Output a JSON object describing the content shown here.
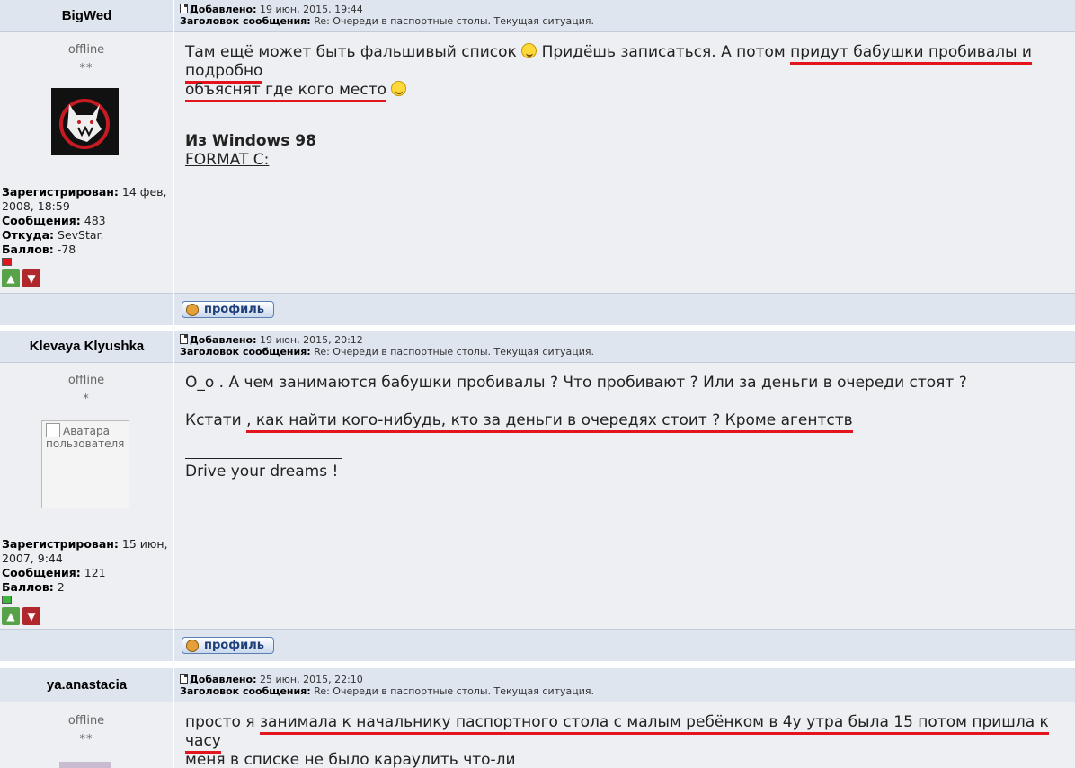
{
  "labels": {
    "added": "Добавлено:",
    "subject": "Заголовок сообщения:",
    "registered": "Зарегистрирован:",
    "messages": "Сообщения:",
    "from": "Откуда:",
    "points": "Баллов:",
    "profile_button": "профиль",
    "avatar_alt": "Аватара пользователя"
  },
  "posts": [
    {
      "username": "BigWed",
      "date": "19 июн, 2015, 19:44",
      "subject": "Re: Очереди в паспортные столы. Текущая ситуация.",
      "status": "offline",
      "stars": "**",
      "registered": "14 фев, 2008, 18:59",
      "registered_l1": "14 фев,",
      "registered_l2": "2008, 18:59",
      "messages": "483",
      "from": "SevStar.",
      "points": "-78",
      "rep_color": "#e3141b",
      "msg_l1_a": "Там ещё может быть фальшивый список ",
      "msg_l1_b": " Придёшь записаться. А потом ",
      "msg_l1_hl": "придут бабушки пробивалы и подробно",
      "msg_l2_hl": "объяснят где кого место",
      "sig_bold": "Из Windows 98",
      "sig_ul": "FORMAT C:"
    },
    {
      "username": "Klevaya Klyushka",
      "date": "19 июн, 2015, 20:12",
      "subject": "Re: Очереди в паспортные столы. Текущая ситуация.",
      "status": "offline",
      "stars": "*",
      "registered_l1": "15 июн,",
      "registered_l2": "2007, 9:44",
      "messages": "121",
      "points": "2",
      "rep_color": "#3db53d",
      "msg_l1": "O_o . А чем занимаются бабушки пробивалы ? Что пробивают ? Или за деньги в очереди стоят ?",
      "msg_l2_a": "Кстати ",
      "msg_l2_hl": ", как найти кого-нибудь, кто за деньги в очередях стоит ? Кроме агентств",
      "sig_text": "Drive your dreams !"
    },
    {
      "username": "ya.anastacia",
      "date": "25 июн, 2015, 22:10",
      "subject": "Re: Очереди в паспортные столы. Текущая ситуация.",
      "status": "offline",
      "stars": "**",
      "msg_l1_a": "просто я ",
      "msg_l1_hl": "занимала к начальнику паспортного стола с малым ребёнком в 4у утра была 15 потом пришла к часу",
      "msg_l2_hl": "меня в списке не было",
      "msg_l2_b": " караулить что-ли"
    }
  ]
}
